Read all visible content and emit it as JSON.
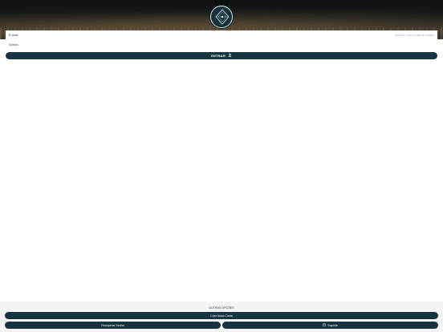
{
  "colors": {
    "primary": "#163540",
    "background": "#ffffff",
    "footer": "#f4f4f4"
  },
  "logo": {
    "icon": "diamond-seal-icon"
  },
  "form": {
    "email_label": "E-mail",
    "email_placeholder": "Informe o seu e-mail de acesso",
    "password_label": "Senha",
    "submit_label": "ENTRAR",
    "submit_icon": "login-arrow-icon"
  },
  "other_options": {
    "title": "OUTRAS OPÇÕES",
    "create_label": "Criar Nova Conta",
    "reset_label": "Recuperar Senha",
    "help_label": "Suporte",
    "help_icon": "help-icon"
  }
}
